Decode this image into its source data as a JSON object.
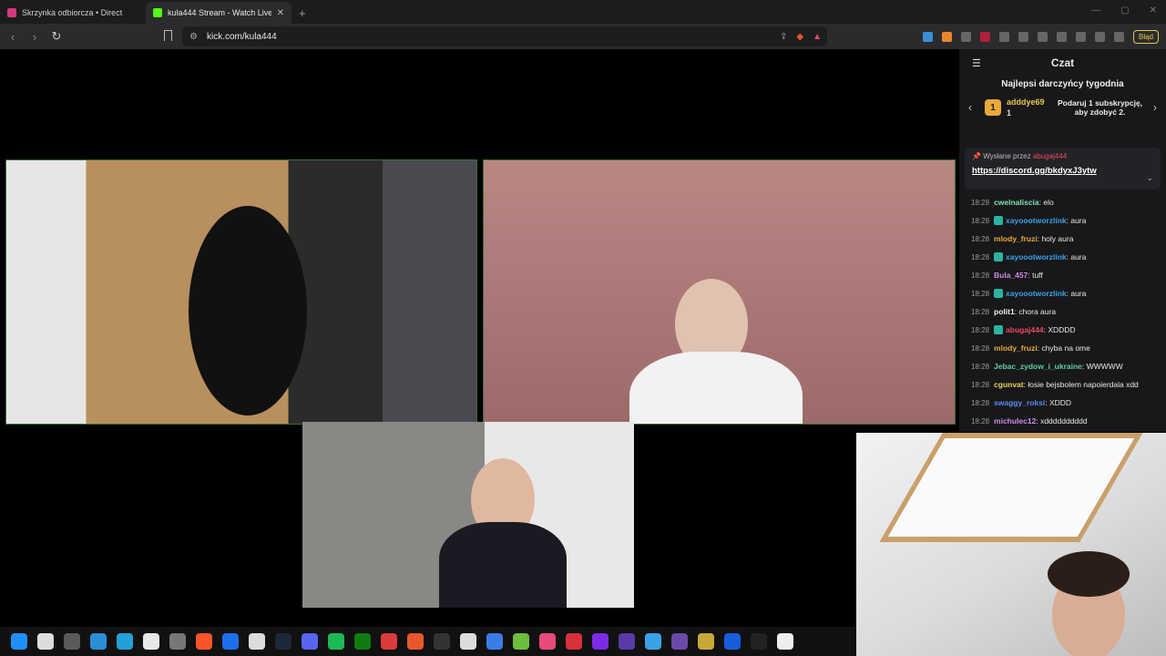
{
  "browser": {
    "tabs": [
      {
        "title": "Skrzynka odbiorcza • Direct",
        "color": "#d6397a"
      },
      {
        "title": "kula444 Stream - Watch Live",
        "color": "#53fc18"
      }
    ],
    "url": "kick.com/kula444",
    "error_button": "Błąd"
  },
  "chat": {
    "title": "Czat",
    "top_gifters_title": "Najlepsi darczyńcy tygodnia",
    "top_gifter": {
      "rank": "1",
      "name": "adddye69",
      "count": "1"
    },
    "gift_cta": "Podaruj 1 subskrypcję, aby zdobyć 2.",
    "pinned": {
      "sent_by_label": "Wysłane przez",
      "user": "abugaj444",
      "link": "https://discord.gg/bkdyxJ3ytw"
    },
    "messages": [
      {
        "time": "18:28",
        "user": "cwelnaliscia",
        "text": ": elo",
        "color": "#7de3b0",
        "icon": false
      },
      {
        "time": "18:28",
        "user": "xayoootworzlink",
        "text": ": aura",
        "color": "#3aa3e8",
        "icon": true
      },
      {
        "time": "18:28",
        "user": "mlody_fruzi",
        "text": ": holy aura",
        "color": "#e8a93a",
        "icon": false
      },
      {
        "time": "18:28",
        "user": "xayoootworzlink",
        "text": ": aura",
        "color": "#3aa3e8",
        "icon": true
      },
      {
        "time": "18:28",
        "user": "Bula_457",
        "text": ": tuff",
        "color": "#c98ce8",
        "icon": false
      },
      {
        "time": "18:28",
        "user": "xayoootworzlink",
        "text": ": aura",
        "color": "#3aa3e8",
        "icon": true
      },
      {
        "time": "18:28",
        "user": "polit1",
        "text": ": chora aura",
        "color": "#f0f0f0",
        "icon": false
      },
      {
        "time": "18:28",
        "user": "abugaj444",
        "text": ": XDDDD",
        "color": "#e84a5f",
        "icon": true
      },
      {
        "time": "18:28",
        "user": "mlody_fruzi",
        "text": ": chyba na ome",
        "color": "#e8a93a",
        "icon": false
      },
      {
        "time": "18:28",
        "user": "Jebac_zydow_i_ukraine",
        "text": ": WWWWW",
        "color": "#5fd0a0",
        "icon": false
      },
      {
        "time": "18:28",
        "user": "cgunvat",
        "text": ": łosie bejsbolem napoierdala xdd",
        "color": "#e8d35a",
        "icon": false
      },
      {
        "time": "18:28",
        "user": "swaggy_roksi",
        "text": ": XDDD",
        "color": "#5a8ce8",
        "icon": false
      },
      {
        "time": "18:28",
        "user": "michulec12",
        "text": ": xdddddddddd",
        "color": "#c98ce8",
        "icon": false
      }
    ]
  },
  "taskbar": {
    "icons": [
      "windows-icon",
      "search-icon",
      "explorer-icon",
      "photos-icon",
      "monitor-icon",
      "notepad-icon",
      "vpn-icon",
      "brave-icon",
      "messenger-icon",
      "g-icon",
      "steam-icon",
      "discord-icon",
      "spotify-icon",
      "xbox-icon",
      "app-red-icon",
      "app-orange-icon",
      "epic-icon",
      "app-circle-icon",
      "app-blue-icon",
      "app-green-icon",
      "app-pink-icon",
      "app-red2-icon",
      "canva-icon",
      "app-purple-icon",
      "app-link-icon",
      "obs-icon",
      "app-yellow-icon",
      "bitwarden-icon",
      "capcut-icon",
      "clock-icon"
    ],
    "colors": [
      "#1e90ff",
      "#dddddd",
      "#5a5a5a",
      "#2a8fd6",
      "#23a0d8",
      "#e8e8e8",
      "#777777",
      "#fb542b",
      "#1e6ef0",
      "#dddddd",
      "#1b2838",
      "#5865f2",
      "#1db954",
      "#107c10",
      "#d93b3b",
      "#e8572a",
      "#333333",
      "#dddddd",
      "#3a7de8",
      "#6cbf3a",
      "#e84a7a",
      "#d9303a",
      "#7d2ae8",
      "#5a3aa8",
      "#3aa3e8",
      "#6a4aa8",
      "#c9a83a",
      "#175ddc",
      "#222222",
      "#eeeeee"
    ]
  }
}
